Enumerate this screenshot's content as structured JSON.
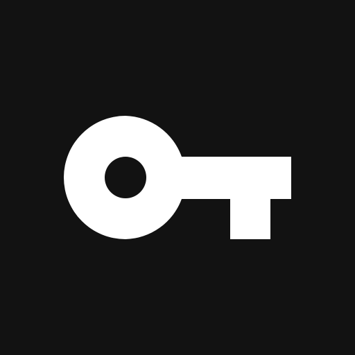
{
  "icon": {
    "name": "key-icon",
    "foreground_color": "#ffffff",
    "background_color": "#121212"
  }
}
